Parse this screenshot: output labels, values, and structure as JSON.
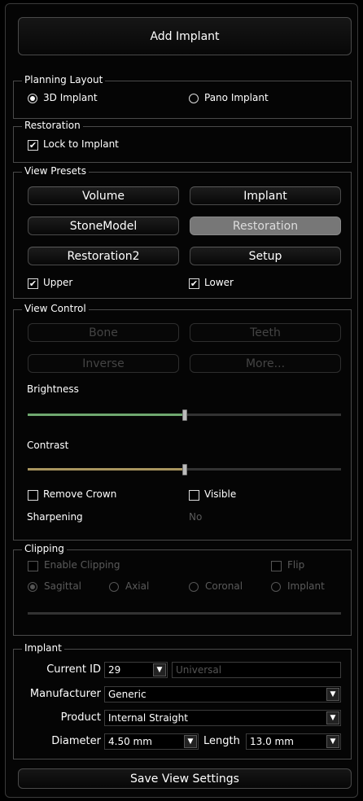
{
  "add_implant": "Add Implant",
  "planning_layout": {
    "title": "Planning Layout",
    "opt_3d": "3D Implant",
    "opt_pano": "Pano Implant",
    "selected": "3D Implant"
  },
  "restoration": {
    "title": "Restoration",
    "lock_label": "Lock to Implant",
    "lock_checked": true
  },
  "view_presets": {
    "title": "View Presets",
    "buttons": [
      "Volume",
      "Implant",
      "StoneModel",
      "Restoration",
      "Restoration2",
      "Setup"
    ],
    "active": "Restoration",
    "upper_label": "Upper",
    "lower_label": "Lower",
    "upper_checked": true,
    "lower_checked": true
  },
  "view_control": {
    "title": "View Control",
    "buttons": [
      "Bone",
      "Teeth",
      "Inverse",
      "More..."
    ],
    "brightness_label": "Brightness",
    "brightness_value": 0.5,
    "contrast_label": "Contrast",
    "contrast_value": 0.5,
    "remove_crown_label": "Remove Crown",
    "visible_label": "Visible",
    "sharpening_label": "Sharpening",
    "sharpening_value": "No",
    "brightness_color": "#6fa86f",
    "contrast_color": "#a8955f"
  },
  "clipping": {
    "title": "Clipping",
    "enable_label": "Enable Clipping",
    "flip_label": "Flip",
    "sagittal": "Sagittal",
    "axial": "Axial",
    "coronal": "Coronal",
    "implant": "Implant",
    "selected": "Sagittal"
  },
  "implant": {
    "title": "Implant",
    "current_id_label": "Current ID",
    "current_id": "29",
    "universal_placeholder": "Universal",
    "manufacturer_label": "Manufacturer",
    "manufacturer": "Generic",
    "product_label": "Product",
    "product": "Internal Straight",
    "diameter_label": "Diameter",
    "diameter": "4.50 mm",
    "length_label": "Length",
    "length": "13.0 mm"
  },
  "save_view_settings": "Save View Settings"
}
